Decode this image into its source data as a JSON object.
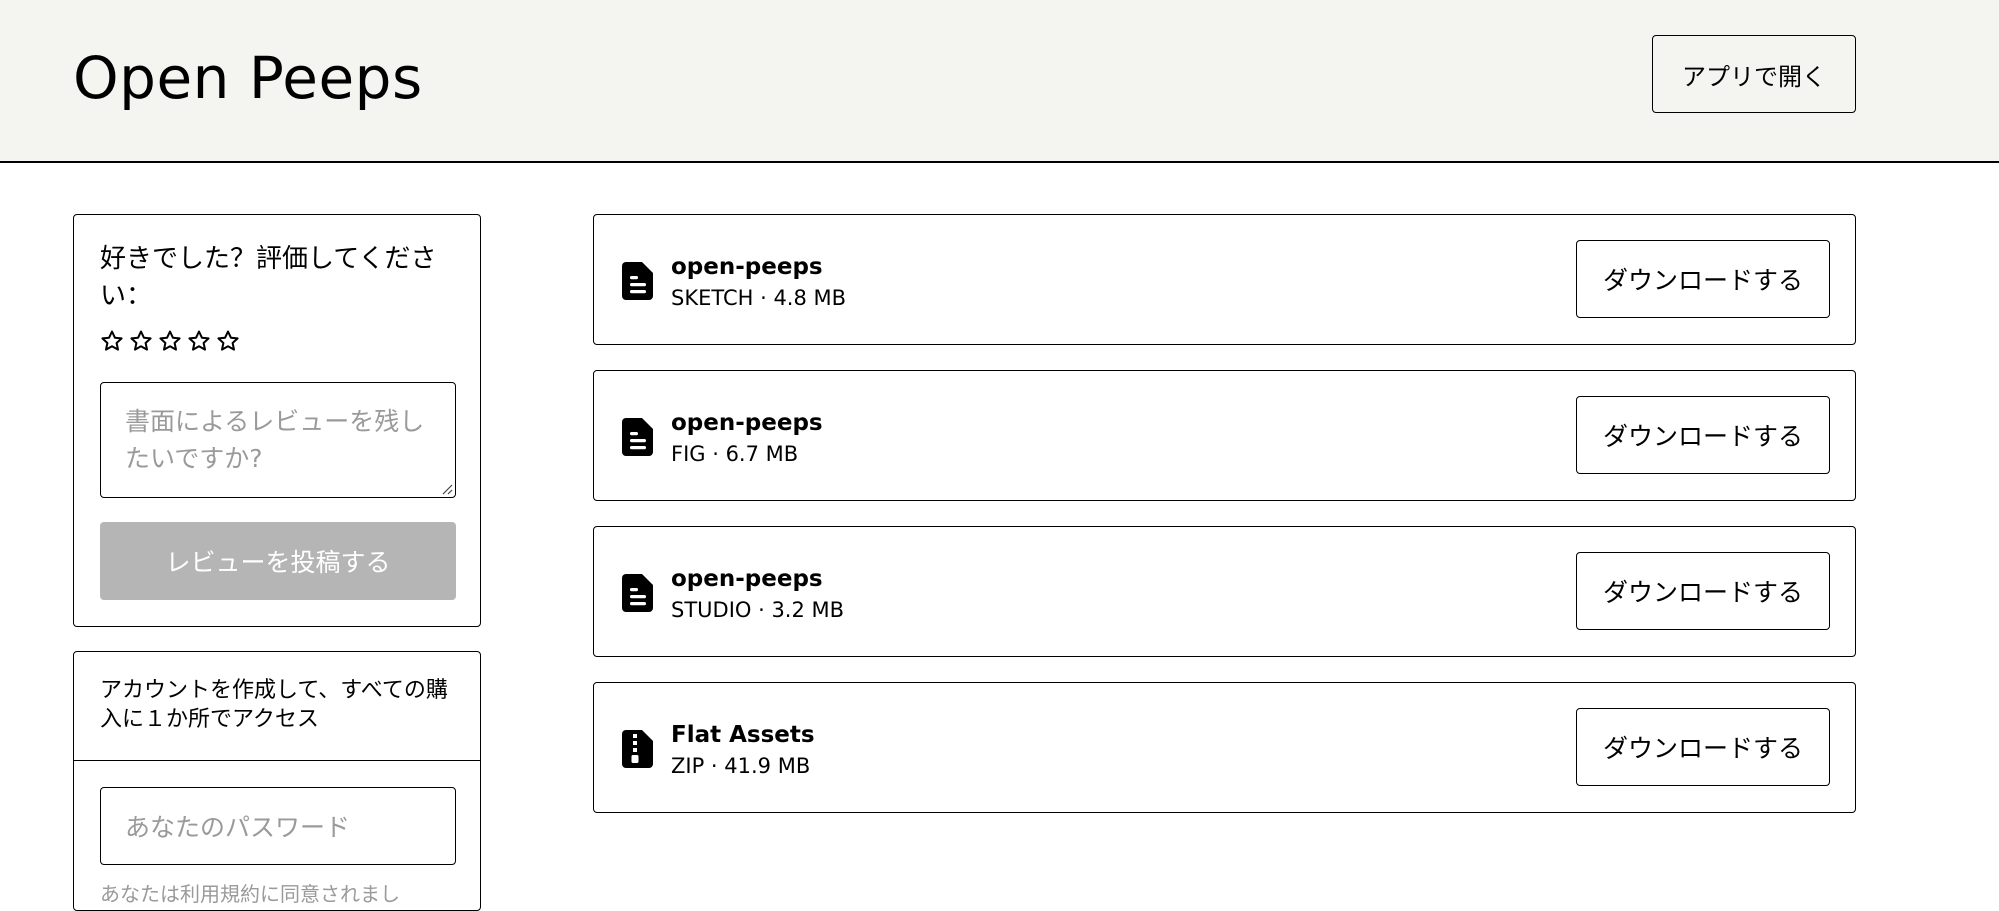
{
  "header": {
    "title": "Open Peeps",
    "open_app_label": "アプリで開く"
  },
  "review": {
    "title": "好きでした？評価してください：",
    "star_count": 5,
    "rating": 0,
    "textarea_placeholder": "書面によるレビューを残したいですか?",
    "post_label": "レビューを投稿する"
  },
  "account": {
    "text": "アカウントを作成して、すべての購入に１か所でアクセス",
    "password_placeholder": "あなたのパスワード",
    "terms_text": "あなたは利用規約に同意されまし"
  },
  "files": [
    {
      "name": "open-peeps",
      "meta": "SKETCH · 4.8 MB",
      "icon": "file-text-icon",
      "download_label": "ダウンロードする"
    },
    {
      "name": "open-peeps",
      "meta": "FIG · 6.7 MB",
      "icon": "file-text-icon",
      "download_label": "ダウンロードする"
    },
    {
      "name": "open-peeps",
      "meta": "STUDIO · 3.2 MB",
      "icon": "file-text-icon",
      "download_label": "ダウンロードする"
    },
    {
      "name": "Flat Assets",
      "meta": "ZIP · 41.9 MB",
      "icon": "file-zip-icon",
      "download_label": "ダウンロードする"
    }
  ]
}
